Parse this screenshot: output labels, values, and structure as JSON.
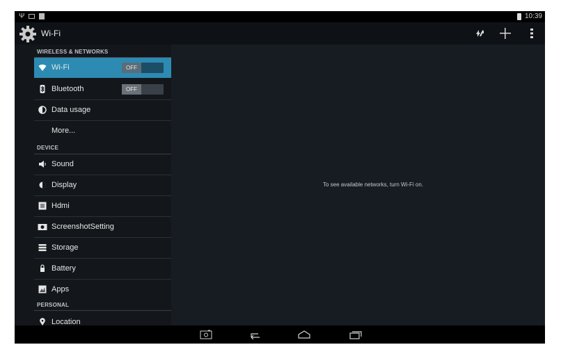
{
  "status_bar": {
    "time": "10:39",
    "icons": [
      "usb-icon",
      "debug-icon",
      "sd-card-icon",
      "battery-icon"
    ]
  },
  "action_bar": {
    "title": "Wi-Fi",
    "icons": [
      "settings-gear-icon",
      "wps-icon",
      "add-network-icon",
      "overflow-menu-icon"
    ]
  },
  "sidebar": {
    "sections": [
      {
        "header": "WIRELESS & NETWORKS",
        "items": [
          {
            "label": "Wi-Fi",
            "icon": "wifi-icon",
            "toggle": "OFF",
            "selected": true
          },
          {
            "label": "Bluetooth",
            "icon": "bluetooth-icon",
            "toggle": "OFF"
          },
          {
            "label": "Data usage",
            "icon": "data-usage-icon"
          },
          {
            "label": "More...",
            "icon": ""
          }
        ]
      },
      {
        "header": "DEVICE",
        "items": [
          {
            "label": "Sound",
            "icon": "sound-icon"
          },
          {
            "label": "Display",
            "icon": "display-icon"
          },
          {
            "label": "Hdmi",
            "icon": "hdmi-icon"
          },
          {
            "label": "ScreenshotSetting",
            "icon": "camera-icon"
          },
          {
            "label": "Storage",
            "icon": "storage-icon"
          },
          {
            "label": "Battery",
            "icon": "battery-icon"
          },
          {
            "label": "Apps",
            "icon": "apps-icon"
          }
        ]
      },
      {
        "header": "PERSONAL",
        "items": [
          {
            "label": "Location",
            "icon": "location-icon"
          }
        ]
      }
    ]
  },
  "content": {
    "message": "To see available networks, turn Wi-Fi on."
  },
  "nav_bar": {
    "icons": [
      "screenshot-icon",
      "back-icon",
      "home-icon",
      "recent-apps-icon"
    ]
  },
  "colors": {
    "accent": "#2d8bb3",
    "background": "#171c22",
    "sidebar": "#13171b"
  }
}
